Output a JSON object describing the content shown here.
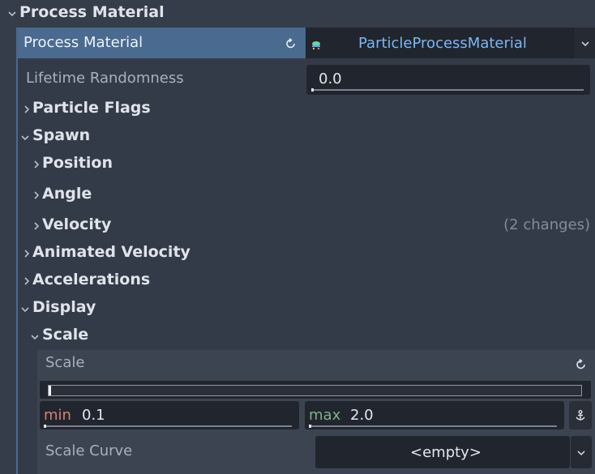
{
  "top_section": {
    "title": "Process Material"
  },
  "resource_row": {
    "label": "Process Material",
    "resource_name": "ParticleProcessMaterial"
  },
  "lifetime_randomness": {
    "label": "Lifetime Randomness",
    "value": "0.0"
  },
  "groups": {
    "particle_flags": "Particle Flags",
    "spawn": "Spawn",
    "position": "Position",
    "angle": "Angle",
    "velocity": "Velocity",
    "velocity_changes": "(2 changes)",
    "animated_velocity": "Animated Velocity",
    "accelerations": "Accelerations",
    "display": "Display",
    "scale_group": "Scale"
  },
  "scale": {
    "label": "Scale",
    "min_label": "min",
    "min_value": "0.1",
    "max_label": "max",
    "max_value": "2.0"
  },
  "scale_curve": {
    "label": "Scale Curve",
    "value": "<empty>"
  },
  "colors": {
    "panel_bg": "#363d4a",
    "selected_row": "#4a6a90",
    "accent_text": "#7ab7f5",
    "min_label": "#d6836a",
    "max_label": "#7fb08a"
  }
}
